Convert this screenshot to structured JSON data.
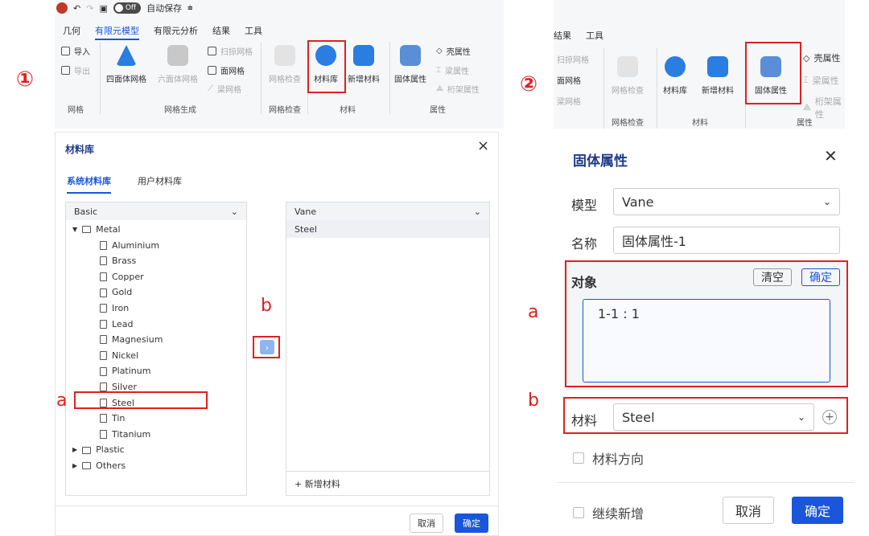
{
  "ribbon1": {
    "menu": [
      "几何",
      "有限元模型",
      "有限元分析",
      "结果",
      "工具"
    ],
    "autosave_toggle": "Off",
    "autosave_label": "自动保存",
    "import": "导入",
    "export": "导出",
    "tetra": "四面体网格",
    "hexa": "六面体网格",
    "sweep": "扫掠网格",
    "surface": "面网格",
    "beam": "梁网格",
    "check": "网格检查",
    "matlib": "材料库",
    "newmat": "新增材料",
    "solid": "固体属性",
    "shell": "壳属性",
    "beamprop": "梁属性",
    "truss": "桁架属性",
    "groups": [
      "网格",
      "网格生成",
      "网格检查",
      "材料",
      "属性"
    ]
  },
  "ribbon2": {
    "menu": [
      "结果",
      "工具"
    ],
    "sweep": "扫掠网格",
    "surface": "面网格",
    "beam": "梁网格",
    "check": "网格检查",
    "matlib": "材料库",
    "newmat": "新增材料",
    "solid": "固体属性",
    "shell": "壳属性",
    "beamprop": "梁属性",
    "truss": "桁架属性",
    "groups": [
      "网格检查",
      "材料",
      "属性"
    ]
  },
  "markers": {
    "step1": "①",
    "step2": "②",
    "a": "a",
    "b": "b",
    "a2": "a",
    "b2": "b"
  },
  "matlib_dialog": {
    "title": "材料库",
    "close": "×",
    "tabs": [
      "系统材料库",
      "用户材料库"
    ],
    "left_select": "Basic",
    "tree": {
      "metal": "Metal",
      "items": [
        "Aluminium",
        "Brass",
        "Copper",
        "Gold",
        "Iron",
        "Lead",
        "Magnesium",
        "Nickel",
        "Platinum",
        "Silver",
        "Steel",
        "Tin",
        "Titanium"
      ],
      "plastic": "Plastic",
      "others": "Others"
    },
    "transfer": "›",
    "right_select": "Vane",
    "right_items": [
      "Steel"
    ],
    "add_material": "+ 新增材料",
    "cancel": "取消",
    "ok": "确定"
  },
  "solid_dialog": {
    "title": "固体属性",
    "close": "✕",
    "model_label": "模型",
    "model_value": "Vane",
    "name_label": "名称",
    "name_value": "固体属性-1",
    "object_label": "对象",
    "clear": "清空",
    "confirm": "确定",
    "object_value": "1-1 : 1",
    "material_label": "材料",
    "material_value": "Steel",
    "direction_label": "材料方向",
    "continue_label": "继续新增",
    "cancel": "取消",
    "ok": "确定"
  }
}
